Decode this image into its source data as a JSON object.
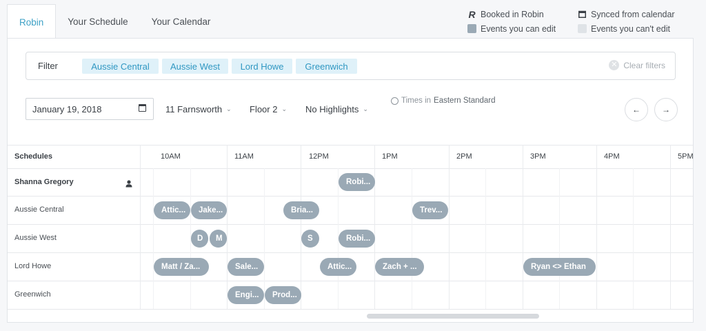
{
  "tabs": [
    {
      "label": "Robin"
    },
    {
      "label": "Your Schedule"
    },
    {
      "label": "Your Calendar"
    }
  ],
  "legend": {
    "booked": "Booked in Robin",
    "synced": "Synced from calendar",
    "editable": "Events you can edit",
    "not_editable": "Events you can't edit",
    "booked_icon": "R"
  },
  "filter": {
    "label": "Filter",
    "chips": [
      "Aussie Central",
      "Aussie West",
      "Lord Howe",
      "Greenwich"
    ],
    "clear": "Clear filters"
  },
  "controls": {
    "date": "January 19, 2018",
    "building": "11 Farnsworth",
    "floor": "Floor 2",
    "highlights": "No Highlights",
    "tz_prefix": "Times in",
    "tz_value": "Eastern Standard",
    "prev": "←",
    "next": "→"
  },
  "grid": {
    "header": "Schedules",
    "hours": [
      "10AM",
      "11AM",
      "12PM",
      "1PM",
      "2PM",
      "3PM",
      "4PM",
      "5PM"
    ],
    "rows": [
      "Shanna Gregory",
      "Aussie Central",
      "Aussie West",
      "Lord Howe",
      "Greenwich"
    ]
  },
  "events": {
    "shanna": [
      "Robi..."
    ],
    "aussie_central": [
      "Attic...",
      "Jake...",
      "Bria...",
      "Trev..."
    ],
    "aussie_west": [
      "D",
      "M",
      "S",
      "Robi..."
    ],
    "lord_howe": [
      "Matt / Za...",
      "Sale...",
      "Attic...",
      "Zach + ...",
      "Ryan <> Ethan"
    ],
    "greenwich": [
      "Engi...",
      "Prod..."
    ]
  },
  "colors": {
    "accent": "#3ea1c6",
    "chip_bg": "#dff1f9",
    "event": "#9aa9b5",
    "event_noedit": "#dfe3e7"
  }
}
